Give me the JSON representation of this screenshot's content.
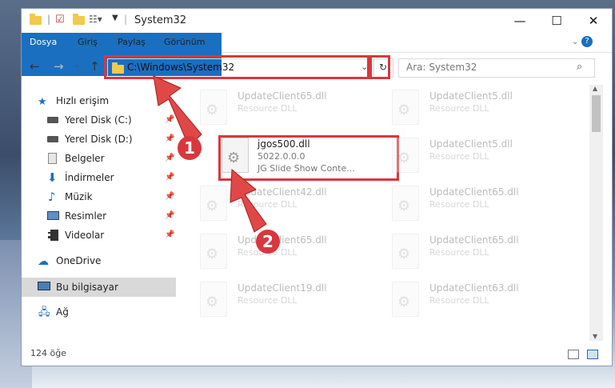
{
  "window": {
    "title": "System32"
  },
  "ribbon": {
    "tabs": [
      "Dosya",
      "Giriş",
      "Paylaş",
      "Görünüm"
    ]
  },
  "navbar": {
    "address": "C:\\Windows\\System32",
    "search_placeholder": "Ara: System32"
  },
  "sidebar": {
    "items": [
      {
        "label": "Hızlı erişim",
        "icon": "star-icon"
      },
      {
        "label": "Yerel Disk (C:)",
        "icon": "drive-icon"
      },
      {
        "label": "Yerel Disk (D:)",
        "icon": "drive-icon"
      },
      {
        "label": "Belgeler",
        "icon": "documents-icon"
      },
      {
        "label": "İndirmeler",
        "icon": "download-icon"
      },
      {
        "label": "Müzik",
        "icon": "music-icon"
      },
      {
        "label": "Resimler",
        "icon": "pictures-icon"
      },
      {
        "label": "Videolar",
        "icon": "videos-icon"
      },
      {
        "label": "OneDrive",
        "icon": "cloud-icon"
      },
      {
        "label": "Bu bilgisayar",
        "icon": "computer-icon"
      },
      {
        "label": "Ağ",
        "icon": "network-icon"
      }
    ]
  },
  "files": [
    {
      "name": "UpdateClient65.dll",
      "desc": "Resource DLL"
    },
    {
      "name": "UpdateClient5.dll",
      "desc": "Resource DLL"
    },
    {
      "name": "jgos500.dll",
      "desc": "5022.0.0.0",
      "desc2": "JG Slide Show Conte..."
    },
    {
      "name": "UpdateClient5.dll",
      "desc": "Resource DLL"
    },
    {
      "name": "UpdateClient42.dll",
      "desc": "Resource DLL"
    },
    {
      "name": "UpdateClient65.dll",
      "desc": "Resource DLL"
    },
    {
      "name": "UpdateClient65.dll",
      "desc": "Resource DLL"
    },
    {
      "name": "UpdateClient65.dll",
      "desc": "Resource DLL"
    },
    {
      "name": "UpdateClient19.dll",
      "desc": "Resource DLL"
    },
    {
      "name": "UpdateClient63.dll",
      "desc": "Resource DLL"
    }
  ],
  "status": {
    "count": "124 öğe"
  },
  "annotations": {
    "step1": "1",
    "step2": "2"
  },
  "colors": {
    "accent": "#1a6fc1",
    "highlight": "#d9373d"
  }
}
